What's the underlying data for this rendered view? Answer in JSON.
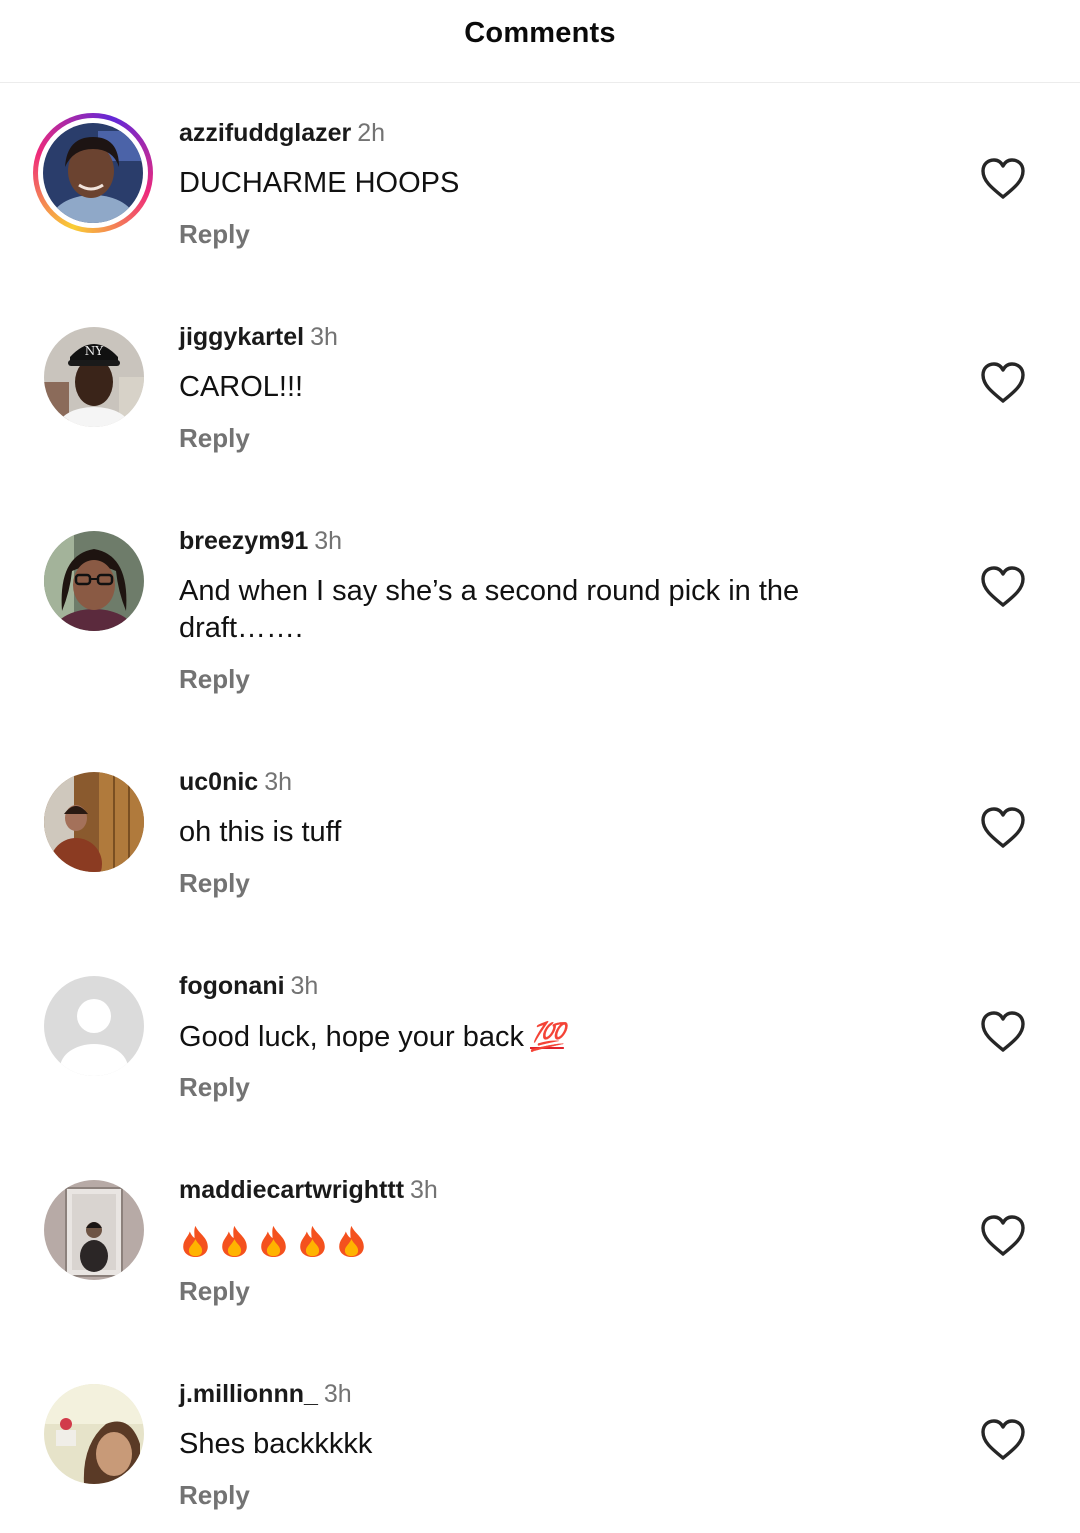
{
  "header": {
    "title": "Comments"
  },
  "comments": [
    {
      "username": "azzifuddglazer",
      "time": "2h",
      "text": "DUCHARME HOOPS",
      "reply": "Reply"
    },
    {
      "username": "jiggykartel",
      "time": "3h",
      "text": "CAROL!!!",
      "reply": "Reply"
    },
    {
      "username": "breezym91",
      "time": "3h",
      "text": "And when I say she’s a second round pick in the draft…….",
      "reply": "Reply"
    },
    {
      "username": "uc0nic",
      "time": "3h",
      "text": "oh this is tuff",
      "reply": "Reply"
    },
    {
      "username": "fogonani",
      "time": "3h",
      "text": "Good luck, hope your back",
      "emoji": "💯",
      "reply": "Reply"
    },
    {
      "username": "maddiecartwrighttt",
      "time": "3h",
      "text": "🔥🔥🔥🔥🔥",
      "reply": "Reply"
    },
    {
      "username": "j.millionnn_",
      "time": "3h",
      "text": "Shes backkkkk",
      "reply": "Reply"
    }
  ],
  "icons": {
    "like": "heart-outline-icon",
    "default_avatar": "default-avatar-icon",
    "fire": "fire-emoji-icon"
  },
  "colors": {
    "story_ring": [
      "#f9ce34",
      "#ee2a7b",
      "#6228d7"
    ],
    "secondary_text": "#737373",
    "hundred_emoji": "#e0222b",
    "heart_stroke": "#262626"
  }
}
